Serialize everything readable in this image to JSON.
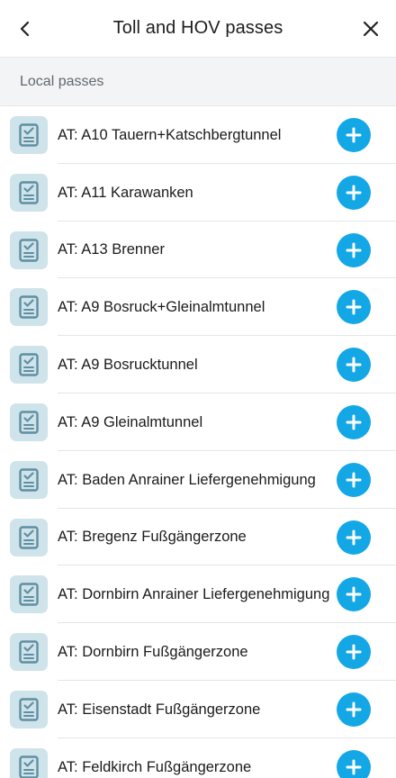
{
  "header": {
    "title": "Toll and HOV passes",
    "back_icon": "chevron-left-icon",
    "close_icon": "close-icon"
  },
  "section": {
    "title": "Local passes"
  },
  "colors": {
    "accent": "#14a7e6",
    "icon_bg": "#cfe3ea",
    "icon_fg": "#5f8fa3"
  },
  "passes": [
    {
      "label": "AT: A10 Tauern+Katschbergtunnel"
    },
    {
      "label": "AT: A11 Karawanken"
    },
    {
      "label": "AT: A13 Brenner"
    },
    {
      "label": "AT: A9 Bosruck+Gleinalmtunnel"
    },
    {
      "label": "AT: A9 Bosrucktunnel"
    },
    {
      "label": "AT: A9 Gleinalmtunnel"
    },
    {
      "label": "AT: Baden Anrainer Liefergenehmigung"
    },
    {
      "label": "AT: Bregenz Fußgängerzone"
    },
    {
      "label": "AT: Dornbirn Anrainer Liefergenehmigung"
    },
    {
      "label": "AT: Dornbirn Fußgängerzone"
    },
    {
      "label": "AT: Eisenstadt Fußgängerzone"
    },
    {
      "label": "AT: Feldkirch Fußgängerzone"
    }
  ]
}
